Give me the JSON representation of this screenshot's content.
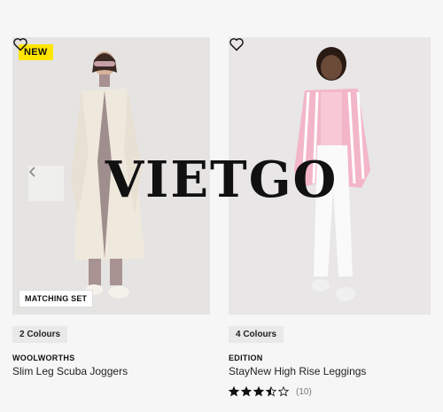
{
  "products": [
    {
      "badge": "NEW",
      "overlay_label": "MATCHING SET",
      "colours": "2 Colours",
      "brand": "WOOLWORTHS",
      "title": "Slim Leg Scuba Joggers"
    },
    {
      "colours": "4 Colours",
      "brand": "EDITION",
      "title": "StayNew High Rise Leggings",
      "rating": {
        "value": 3.5,
        "max": 5,
        "count_label": "(10)"
      }
    }
  ],
  "carousel": {
    "prev_icon": "chevron-left-icon"
  },
  "wishlist_icon": "heart-icon",
  "watermark": "VIETGO",
  "colors": {
    "badge_yellow": "#ffe600",
    "chip_bg": "#e9e9e9"
  }
}
